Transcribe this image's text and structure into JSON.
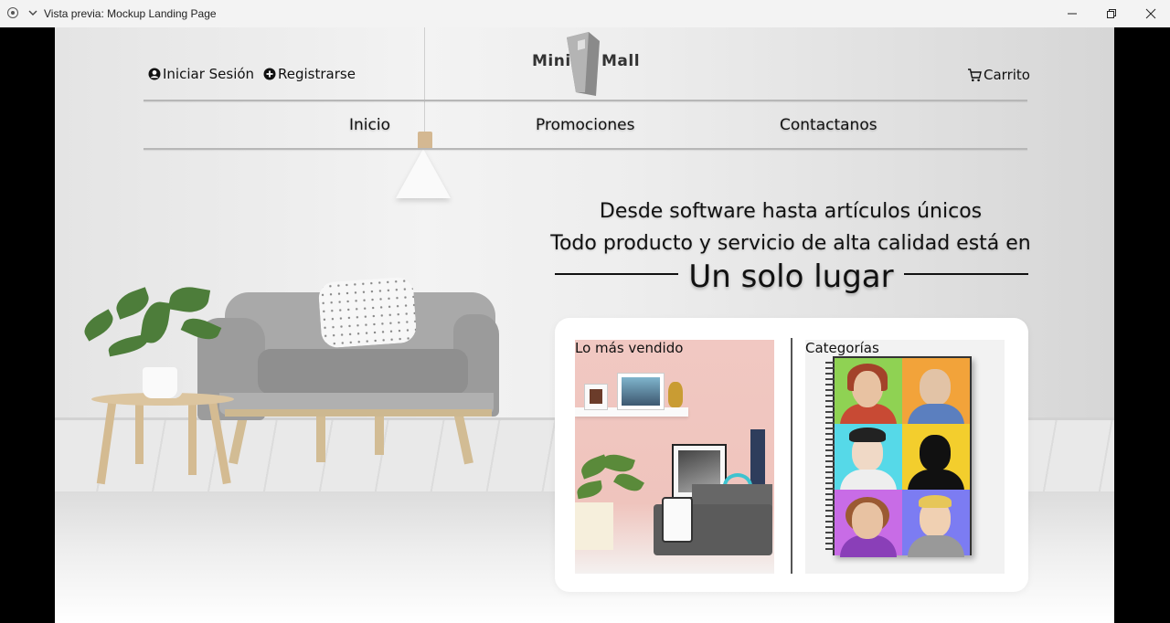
{
  "window": {
    "title": "Vista previa: Mockup Landing Page",
    "icons": [
      "record-icon",
      "chevron-down-icon",
      "minimize-icon",
      "restore-icon",
      "close-icon"
    ]
  },
  "header": {
    "login_label": "Iniciar Sesión",
    "register_label": "Registrarse",
    "cart_label": "Carrito",
    "logo": {
      "word_left": "Mini",
      "word_right": "Mall"
    }
  },
  "nav": {
    "items": [
      {
        "label": "Inicio"
      },
      {
        "label": "Promociones"
      },
      {
        "label": "Contactanos"
      }
    ]
  },
  "hero": {
    "line1": "Desde software hasta artículos únicos",
    "line2": "Todo producto y servicio de alta calidad está en",
    "headline": "Un solo lugar"
  },
  "cards": {
    "best_seller_label": "Lo más vendido",
    "categories_label": "Categorías"
  },
  "colors": {
    "text": "#111111",
    "card_background": "#ffffff",
    "window_bg": "#000000"
  }
}
